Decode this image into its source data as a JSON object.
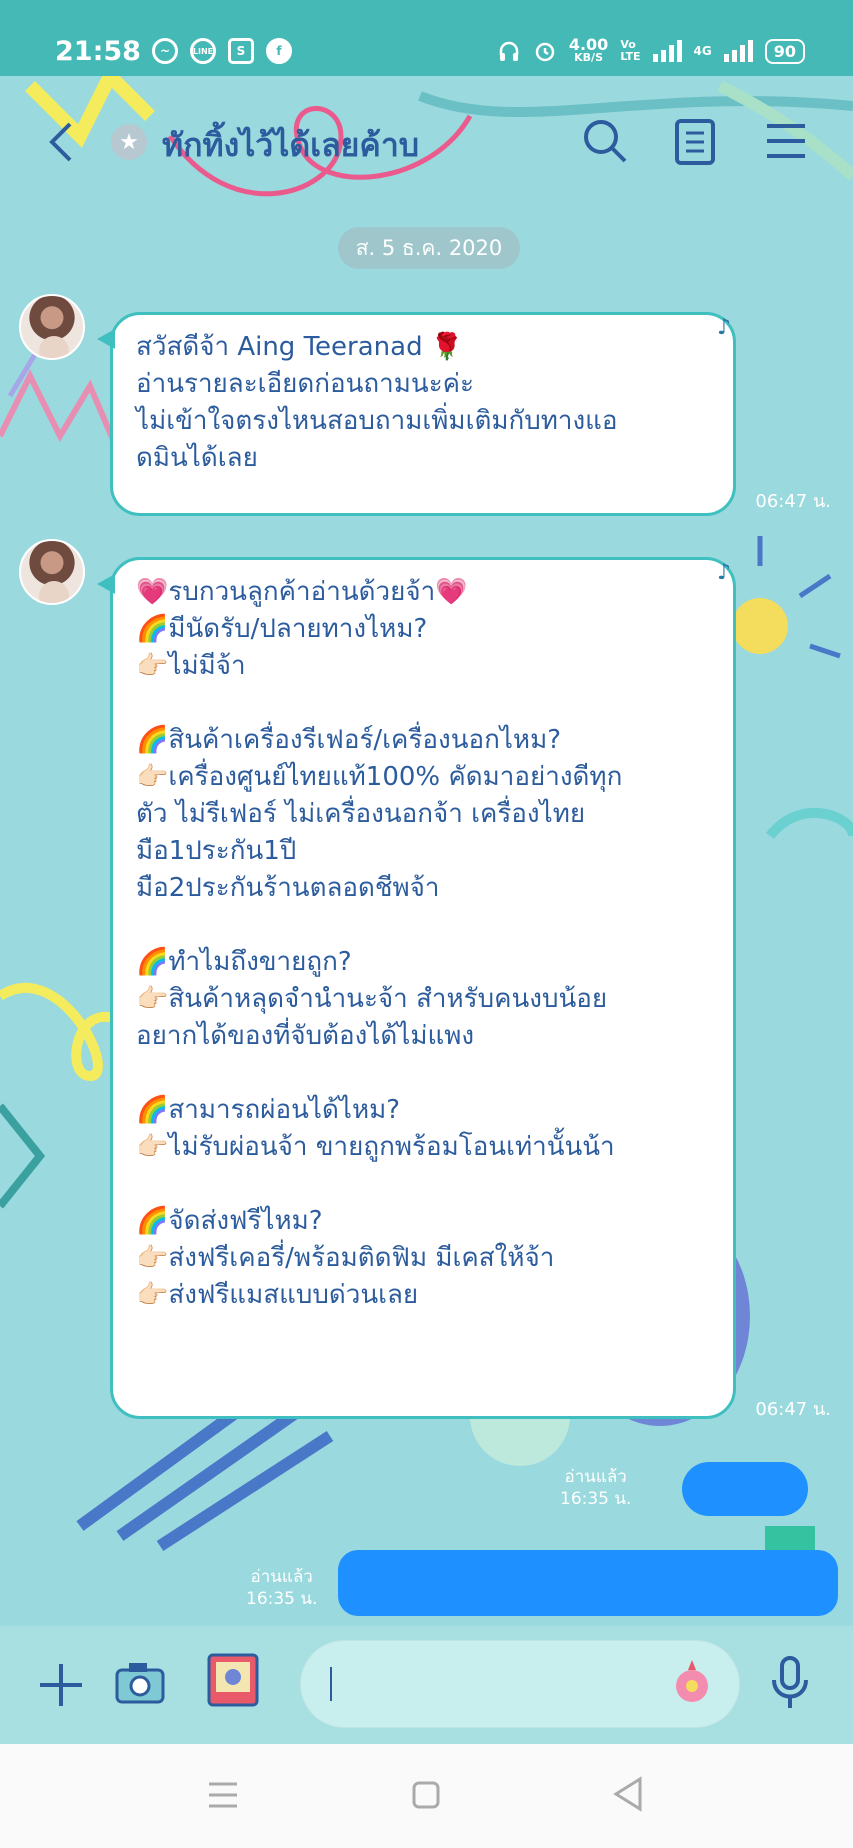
{
  "status_bar": {
    "time": "21:58",
    "app_icons": [
      "messenger-icon",
      "line-icon",
      "shopee-icon",
      "facebook-icon"
    ],
    "net_speed_value": "4.00",
    "net_speed_unit": "KB/S",
    "volte": "Vo\nLTE",
    "network": "4G",
    "battery": "90"
  },
  "header": {
    "title": "ทักทิ้งไว้ได้เลยค้าบ"
  },
  "date_chip": "ส. 5 ธ.ค. 2020",
  "messages": [
    {
      "lines": [
        "สวัสดีจ้า Aing Teeranad 🌹",
        "อ่านรายละเอียดก่อนถามนะค่ะ",
        "ไม่เข้าใจตรงไหนสอบถามเพิ่มเติมกับทางแอ",
        "ดมินได้เลย"
      ],
      "time": "06:47 น."
    },
    {
      "lines": [
        "💗รบกวนลูกค้าอ่านด้วยจ้า💗",
        "🌈มีนัดรับ/ปลายทางไหม?",
        "👉🏻ไม่มีจ้า",
        "",
        "🌈สินค้าเครื่องรีเฟอร์/เครื่องนอกไหม?",
        "👉🏻เครื่องศูนย์ไทยแท้100% คัดมาอย่างดีทุก",
        "ตัว ไม่รีเฟอร์ ไม่เครื่องนอกจ้า เครื่องไทย",
        "มือ1ประกัน1ปี",
        "มือ2ประกันร้านตลอดชีพจ้า",
        "",
        "🌈ทำไมถึงขายถูก?",
        "👉🏻สินค้าหลุดจำนำนะจ้า สำหรับคนงบน้อย",
        "อยากได้ของที่จับต้องได้ไม่แพง",
        "",
        "🌈สามารถผ่อนได้ไหม?",
        "👉🏻ไม่รับผ่อนจ้า ขายถูกพร้อมโอนเท่านั้นน้า",
        "",
        "🌈จัดส่งฟรีไหม?",
        "👉🏻ส่งฟรีเคอรี่/พร้อมติดฟิม มีเคสให้จ้า",
        "👉🏻ส่งฟรีแมสแบบด่วนเลย"
      ],
      "time": "06:47 น."
    }
  ],
  "sent": [
    {
      "read": "อ่านแล้ว",
      "time": "16:35 น."
    },
    {
      "read": "อ่านแล้ว",
      "time": "16:35 น."
    }
  ],
  "colors": {
    "status_bar": "#44b9b5",
    "chat_bg": "#9ad9de",
    "bubble_border": "#3fbfbf",
    "text": "#2c5c9d",
    "redaction": "#1e90ff"
  }
}
